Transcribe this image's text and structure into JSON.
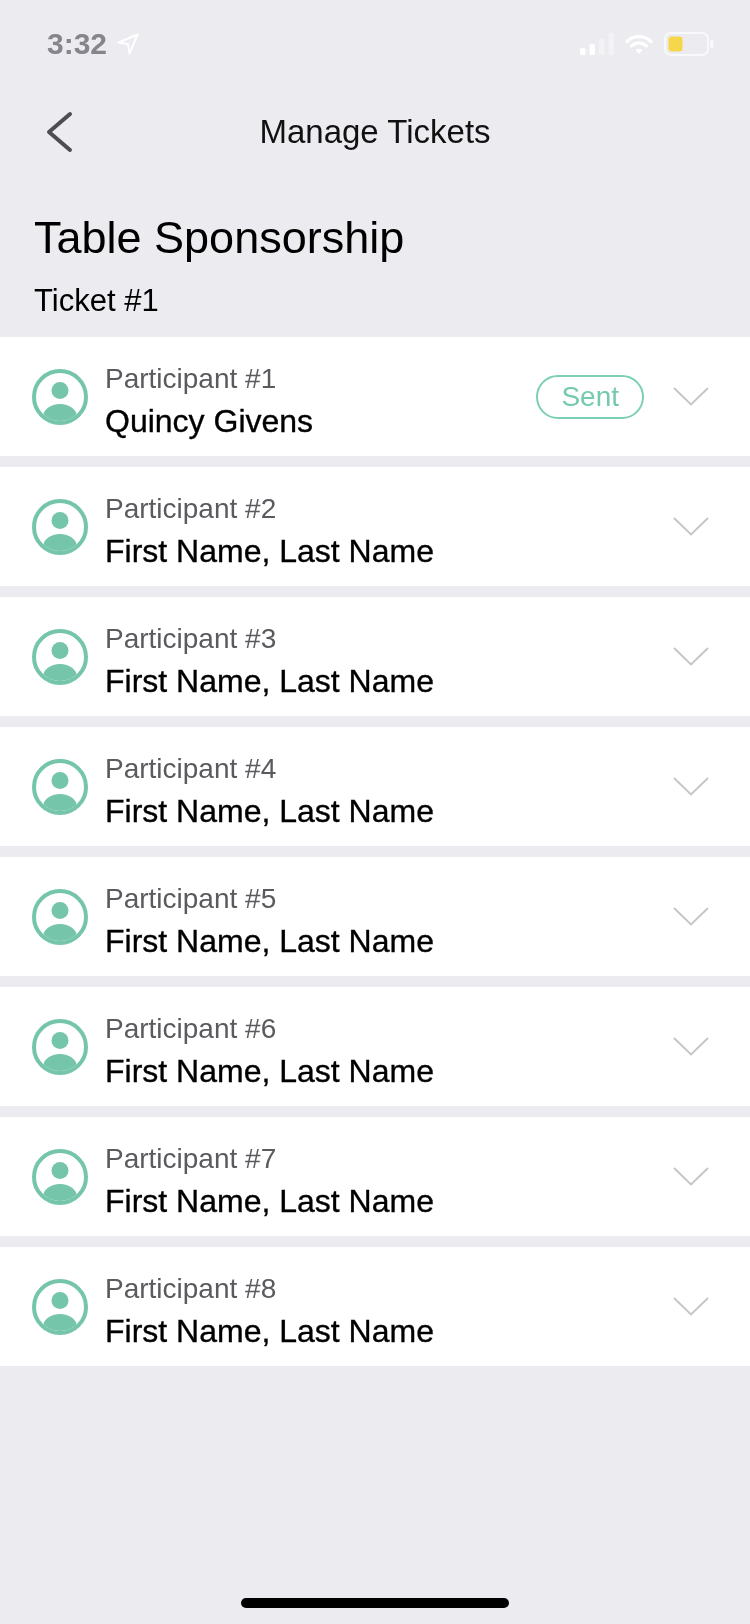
{
  "status_bar": {
    "time": "3:32"
  },
  "nav": {
    "title": "Manage Tickets"
  },
  "header": {
    "title": "Table Sponsorship",
    "subtitle": "Ticket #1"
  },
  "participants": [
    {
      "label": "Participant #1",
      "name": "Quincy Givens",
      "badge": "Sent",
      "expanded": false
    },
    {
      "label": "Participant #2",
      "name": "First Name, Last Name",
      "expanded": false
    },
    {
      "label": "Participant #3",
      "name": "First Name, Last Name",
      "expanded": false
    },
    {
      "label": "Participant #4",
      "name": "First Name, Last Name",
      "expanded": false
    },
    {
      "label": "Participant #5",
      "name": "First Name, Last Name",
      "expanded": false
    },
    {
      "label": "Participant #6",
      "name": "First Name, Last Name",
      "expanded": false
    },
    {
      "label": "Participant #7",
      "name": "First Name, Last Name",
      "expanded": false
    },
    {
      "label": "Participant #8",
      "name": "First Name, Last Name",
      "expanded": false
    }
  ]
}
